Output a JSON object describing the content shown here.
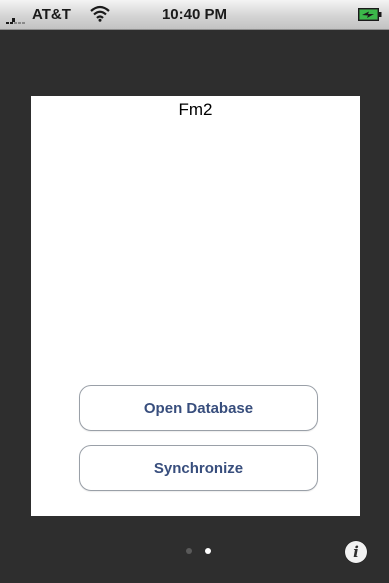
{
  "status_bar": {
    "carrier": "AT&T",
    "time": "10:40 PM",
    "icons": [
      "signal-icon",
      "wifi-icon",
      "battery-icon"
    ],
    "battery_charging": true
  },
  "panel": {
    "title": "Fm2",
    "buttons": [
      {
        "label": "Open Database"
      },
      {
        "label": "Synchronize"
      }
    ]
  },
  "page_control": {
    "page_count": 2,
    "current_page": 2
  },
  "info_button": {
    "icon": "info-icon",
    "glyph": "i"
  },
  "colors": {
    "button_text": "#384e7d",
    "background": "#2e2e2e",
    "panel": "#ffffff",
    "battery": "#3cb84a"
  }
}
